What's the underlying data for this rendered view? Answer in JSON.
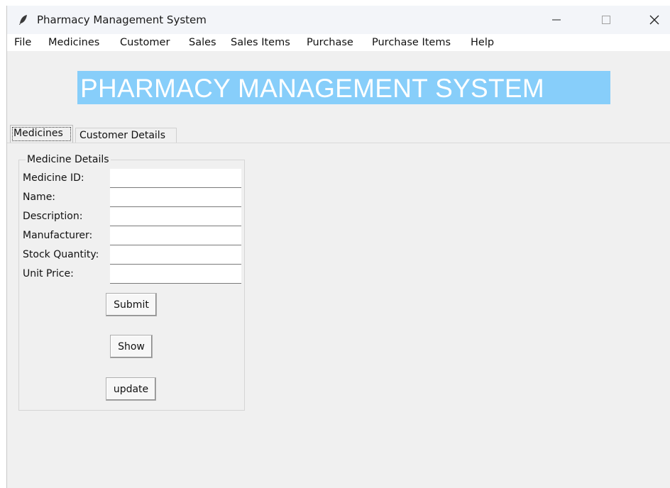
{
  "window": {
    "title": "Pharmacy Management System"
  },
  "menubar": {
    "items": [
      "File",
      "Medicines",
      "Customer",
      "Sales",
      "Sales Items",
      "Purchase",
      "Purchase Items",
      "Help"
    ]
  },
  "banner": {
    "text": "PHARMACY MANAGEMENT SYSTEM",
    "background": "#87cefa",
    "color": "#ffffff"
  },
  "tabs": [
    {
      "label": "Medicines",
      "selected": true
    },
    {
      "label": "Customer Details",
      "selected": false
    }
  ],
  "form": {
    "legend": "Medicine Details",
    "fields": [
      {
        "label": "Medicine ID:",
        "value": ""
      },
      {
        "label": "Name:",
        "value": ""
      },
      {
        "label": "Description:",
        "value": ""
      },
      {
        "label": "Manufacturer:",
        "value": ""
      },
      {
        "label": "Stock Quantity:",
        "value": ""
      },
      {
        "label": "Unit Price:",
        "value": ""
      }
    ],
    "buttons": {
      "submit": "Submit",
      "show": "Show",
      "update": "update"
    }
  },
  "icons": {
    "app": "feather-icon",
    "minimize": "minimize-icon",
    "maximize": "maximize-icon",
    "close": "close-icon"
  }
}
